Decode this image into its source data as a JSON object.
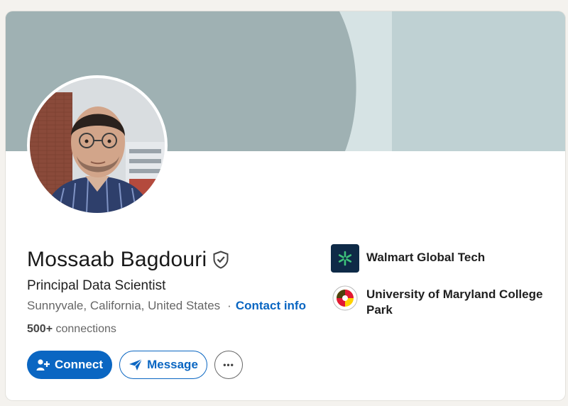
{
  "profile": {
    "name": "Mossaab Bagdouri",
    "headline": "Principal Data Scientist",
    "location": "Sunnyvale, California, United States",
    "separator": "·",
    "contact_label": "Contact info",
    "connections_count": "500+",
    "connections_label": "connections"
  },
  "actions": {
    "connect_label": "Connect",
    "message_label": "Message",
    "more_label": "•••"
  },
  "experience": [
    {
      "label": "Walmart Global Tech",
      "icon": "walmart-spark-icon"
    },
    {
      "label": "University of Maryland College Park",
      "icon": "umd-seal-icon"
    }
  ],
  "colors": {
    "accent": "#0a66c2",
    "banner_left": "#9fb1b3",
    "banner_right": "#bfd1d3",
    "walmart_spark": "#3dc37b"
  }
}
